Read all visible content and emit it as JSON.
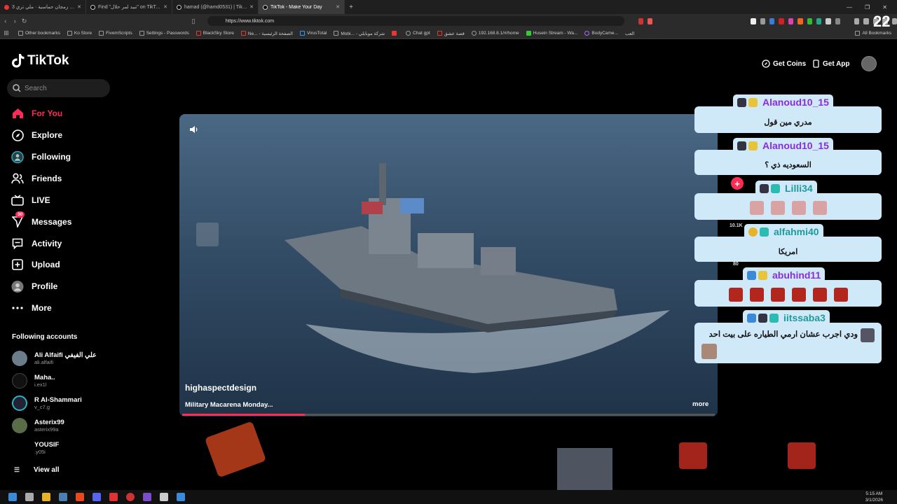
{
  "browser": {
    "tabs": [
      {
        "title": "طوق زمجان حماسية · ملي تري 3 ..."
      },
      {
        "title": "Find \"تبيد لمر حلال\" on TikTok | TikTo..."
      },
      {
        "title": "hamad (@hamd0531) | TikTok | حمد"
      },
      {
        "title": "TikTok - Make Your Day",
        "active": true
      }
    ],
    "new_tab": "+",
    "url": "https://www.tiktok.com",
    "bookmarks": [
      "Other bookmarks",
      "Ko Store",
      "FivemScripts",
      "Settings - Passwords",
      "BlackSky Store",
      "Ne... - الصفحة الرئيسية",
      "VirusTotal",
      "Mobi... - شركة موبايلي",
      "Chat gpt",
      "قصة عشق",
      "192.168.8.1/#/home",
      "Husein Stream - Wa...",
      "BodyCame...",
      "العب"
    ],
    "all_bookmarks": "All Bookmarks"
  },
  "tiktok": {
    "logo": "TikTok",
    "search_placeholder": "Search",
    "nav": [
      {
        "label": "For You",
        "icon": "home-icon",
        "active": true
      },
      {
        "label": "Explore",
        "icon": "compass-icon"
      },
      {
        "label": "Following",
        "icon": "following-icon"
      },
      {
        "label": "Friends",
        "icon": "friends-icon"
      },
      {
        "label": "LIVE",
        "icon": "live-icon"
      },
      {
        "label": "Messages",
        "icon": "messages-icon",
        "badge": "30"
      },
      {
        "label": "Activity",
        "icon": "activity-icon"
      },
      {
        "label": "Upload",
        "icon": "upload-icon"
      },
      {
        "label": "Profile",
        "icon": "profile-icon"
      },
      {
        "label": "More",
        "icon": "more-icon"
      }
    ],
    "following_title": "Following accounts",
    "accounts": [
      {
        "name": "Ali Alfaifi علي الفيفي",
        "handle": "ali.alfaifi"
      },
      {
        "name": "Maha..",
        "handle": "i.ex1l"
      },
      {
        "name": "R Al-Shammari",
        "handle": "v_c7.g"
      },
      {
        "name": "Asterix99",
        "handle": "asterix99a"
      },
      {
        "name": "YOUSIF",
        "handle": ".y05i"
      }
    ],
    "view_all": "View all",
    "get_coins": "Get Coins",
    "get_app": "Get App",
    "video": {
      "creator": "highaspectdesign",
      "caption": "Military Macarena Monday...",
      "more": "more",
      "progress": 0.23
    },
    "side_counts": [
      "10.1K",
      "80"
    ]
  },
  "overlay": {
    "viewer_count": "22",
    "chat": [
      {
        "user": "Alanoud10_15",
        "message": "مدري مين قول"
      },
      {
        "user": "Alanoud10_15",
        "message": "السعوديه ذي ؟"
      },
      {
        "user": "Lilli34",
        "message": ""
      },
      {
        "user": "alfahmi40",
        "message": "امريكا"
      },
      {
        "user": "abuhind11",
        "message": ""
      },
      {
        "user": "iitssaba3",
        "message": "ودي اجرب عشان ارمي الطياره على بيت احد"
      }
    ]
  },
  "taskbar": {
    "time": "5:15 AM",
    "date": "3/1/2026"
  },
  "colors": {
    "accent": "#fe2c55",
    "chat_bg": "#cfe9f9",
    "name_purple": "#8a2be2"
  }
}
